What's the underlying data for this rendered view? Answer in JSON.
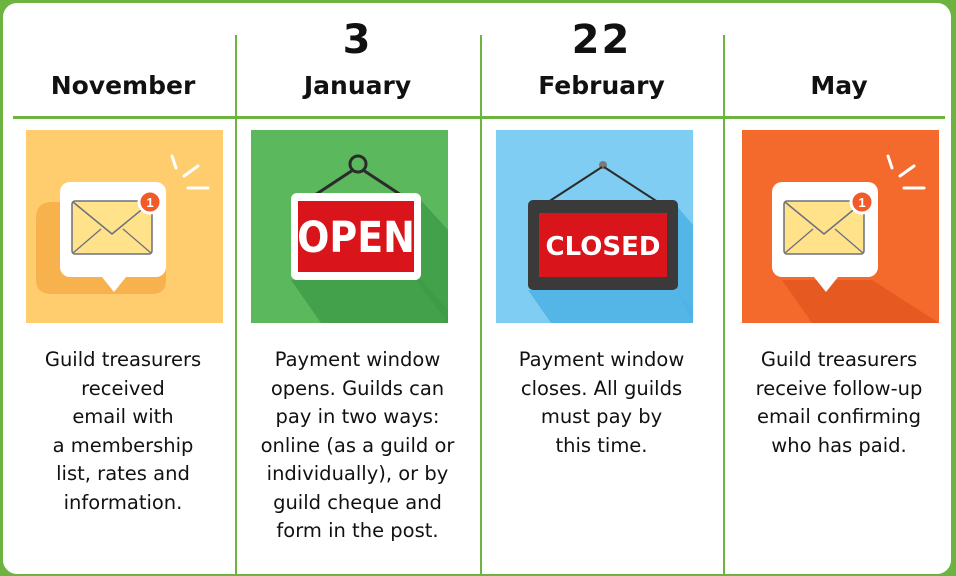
{
  "columns": [
    {
      "date_number": "",
      "month": "November",
      "description": "Guild treasurers\nreceived\nemail with\na membership\nlist, rates and\ninformation.",
      "icon": "email-notification-icon",
      "bg_color": "#ffcd6e"
    },
    {
      "date_number": "3",
      "month": "January",
      "description": "Payment window\nopens. Guilds can\npay in two ways:\nonline (as a guild or\nindividually), or by\nguild cheque and\nform in the post.",
      "icon": "open-sign-icon",
      "sign_text": "OPEN",
      "bg_color": "#5cb85c"
    },
    {
      "date_number": "22",
      "month": "February",
      "description": "Payment window\ncloses. All guilds\nmust pay by\nthis time.",
      "icon": "closed-sign-icon",
      "sign_text": "CLOSED",
      "bg_color": "#7fcdf2"
    },
    {
      "date_number": "",
      "month": "May",
      "description": "Guild treasurers\nreceive follow-up\nemail confirming\nwho has paid.",
      "icon": "email-notification-icon",
      "bg_color": "#f46a2c"
    }
  ],
  "badge_count": "1",
  "colors": {
    "border": "#6db33f",
    "sign_red": "#d9141b"
  }
}
